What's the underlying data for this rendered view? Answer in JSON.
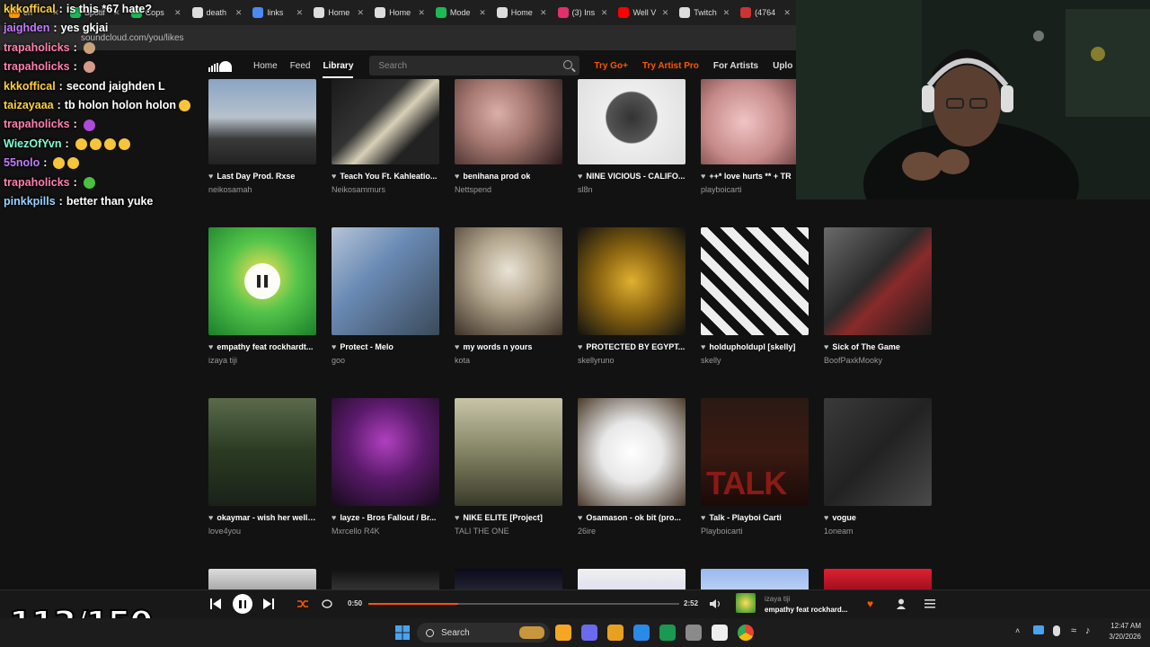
{
  "browser": {
    "tabs": [
      {
        "label": "en",
        "color": "#f90"
      },
      {
        "label": "Spotif",
        "color": "#1db954"
      },
      {
        "label": "Cops",
        "color": "#1db954"
      },
      {
        "label": "death",
        "color": "#ddd"
      },
      {
        "label": "links",
        "color": "#4a8af4"
      },
      {
        "label": "Home",
        "color": "#ddd"
      },
      {
        "label": "Home",
        "color": "#ddd"
      },
      {
        "label": "Mode",
        "color": "#1db954"
      },
      {
        "label": "Home",
        "color": "#ddd"
      },
      {
        "label": "(3) Ins",
        "color": "#e1306c"
      },
      {
        "label": "Well V",
        "color": "#f00"
      },
      {
        "label": "Twitch",
        "color": "#ddd"
      },
      {
        "label": "(4764",
        "color": "#c33"
      }
    ],
    "url": "soundcloud.com/you/likes"
  },
  "header": {
    "nav": [
      "Home",
      "Feed",
      "Library"
    ],
    "active": "Library",
    "search_placeholder": "Search",
    "try_go": "Try Go+",
    "try_artist": "Try Artist Pro",
    "for_artists": "For Artists",
    "upload": "Uplo"
  },
  "rows": [
    [
      {
        "title": "Last Day Prod. Rxse",
        "artist": "neikosamah",
        "bg": "linear-gradient(180deg,#8aa4c4 0%,#b7c2cc 45%,#3a3a3a 70%,#222 100%)"
      },
      {
        "title": "Teach You Ft. Kahleatio...",
        "artist": "Neikosammurs",
        "bg": "linear-gradient(135deg,#1a1a1a 0%,#333 40%,#d8d0b8 55%,#222 75%)"
      },
      {
        "title": "benihana prod ok",
        "artist": "Nettspend",
        "bg": "radial-gradient(circle at 40% 40%,#d9b0a8 0%,#a57770 40%,#2a1a1a 100%)"
      },
      {
        "title": "NINE VICIOUS - CALIFO...",
        "artist": "sl8n",
        "bg": "radial-gradient(circle at 50% 45%,#333 0%,#555 35%,#eee 37%,#ddd 100%)"
      },
      {
        "title": "++* love hurts ** + TR",
        "artist": "playboicarti",
        "bg": "radial-gradient(circle at 40% 50%,#f1c4c4 0%,#c68a8a 50%,#5a3030 100%)"
      }
    ],
    [
      {
        "title": "empathy feat rockhardt...",
        "artist": "izaya tiji",
        "bg": "radial-gradient(circle at 50% 45%,#fbe15a 0%,#54c44a 45%,#1a7f2a 100%)",
        "playing": true
      },
      {
        "title": "Protect - Melo",
        "artist": "goo",
        "bg": "linear-gradient(135deg,#b5c4d8 0%,#6a8ab4 40%,#3a4a5a 100%)"
      },
      {
        "title": "my words n yours",
        "artist": "kota",
        "bg": "radial-gradient(circle at 50% 40%,#e9e3d6 0%,#b4a68e 40%,#3c3228 100%)"
      },
      {
        "title": "PROTECTED BY EGYPT...",
        "artist": "skellyruno",
        "bg": "radial-gradient(circle at 50% 50%,#e0b030 0%,#8a6410 45%,#111 100%)"
      },
      {
        "title": "holdupholdupl [skelly]",
        "artist": "skelly",
        "bg": "repeating-linear-gradient(45deg,#eee 0 10px,#111 10px 20px)"
      },
      {
        "title": "Sick of The Game",
        "artist": "BoofPaxkMooky",
        "bg": "linear-gradient(135deg,#6a6a6a 0%,#2a2a2a 45%,#8a2a2a 60%,#1a1a1a 100%)"
      }
    ],
    [
      {
        "title": "okaymar - wish her well ...",
        "artist": "love4you",
        "bg": "linear-gradient(180deg,#5a6a4a 0%,#2a3a22 50%,#1a2218 100%)"
      },
      {
        "title": "Iayze - Bros Fallout / Br...",
        "artist": "Mxrcello R4K",
        "bg": "radial-gradient(circle at 50% 40%,#b040c0 0%,#5a1a6a 45%,#160a1a 100%)"
      },
      {
        "title": "NIKE ELITE [Project]",
        "artist": "TALI THE ONE",
        "bg": "linear-gradient(180deg,#c8c4a8 0%,#8a8a6a 45%,#3a3a2a 100%)"
      },
      {
        "title": "Osamason - ok bit (pro...",
        "artist": "26ire",
        "bg": "radial-gradient(circle at 50% 50%,#ffffff 0%,#e8e8e8 40%,#4a3a2a 100%)"
      },
      {
        "title": "Talk - Playboi Carti",
        "artist": "Playboicarti",
        "bg": "linear-gradient(180deg,#2a1a14 0%,#3a1a12 50%,#1a0a08 100%)",
        "text": "TALK"
      },
      {
        "title": "vogue",
        "artist": "1oneam",
        "bg": "linear-gradient(135deg,#3a3a3a 0%,#222 50%,#4a4a4a 100%)"
      }
    ],
    [
      {
        "bg": "linear-gradient(180deg,#ddd 0%,#aaa 100%)"
      },
      {
        "bg": "linear-gradient(180deg,#111 0%,#333 100%)"
      },
      {
        "bg": "linear-gradient(180deg,#0a0a1a 0%,#223 100%)"
      },
      {
        "bg": "linear-gradient(180deg,#f0f0f0 0%,#e0e0f0 100%)"
      },
      {
        "bg": "linear-gradient(180deg,#9ab8f0 0%,#b8cff5 100%)"
      },
      {
        "bg": "linear-gradient(180deg,#e02030 0%,#a01020 100%)"
      }
    ]
  ],
  "chat": [
    {
      "user": "kkkoffical",
      "color": "#ffd23f",
      "text": "is this *67 hate?"
    },
    {
      "user": "jaighden",
      "color": "#c27cff",
      "text": "yes gkjai"
    },
    {
      "user": "trapaholicks",
      "color": "#ff7fae",
      "text": "",
      "emote": "#c9a27a"
    },
    {
      "user": "trapaholicks",
      "color": "#ff7fae",
      "text": "",
      "emote": "#d59a8a"
    },
    {
      "user": "kkkoffical",
      "color": "#ffd23f",
      "text": "second jaighden L"
    },
    {
      "user": "taizayaaa",
      "color": "#ffd23f",
      "text": "tb holon holon holon",
      "emote": "#f7c43a"
    },
    {
      "user": "trapaholicks",
      "color": "#ff7fae",
      "text": "",
      "emote": "#b04ad8"
    },
    {
      "user": "WiezOfYvn",
      "color": "#7fffd4",
      "text": "",
      "emotes": 4
    },
    {
      "user": "55nolo",
      "color": "#c27cff",
      "text": "",
      "emotes": 2
    },
    {
      "user": "trapaholicks",
      "color": "#ff7fae",
      "text": "",
      "emote": "#4ac040"
    },
    {
      "user": "pinkkpills",
      "color": "#9ad1ff",
      "text": "better than yuke"
    }
  ],
  "player": {
    "elapsed": "0:50",
    "duration": "2:52",
    "progress": 0.29,
    "artist": "izaya tiji",
    "title": "empathy feat rockhard...",
    "counter": "113/150"
  },
  "taskbar": {
    "search": "Search",
    "time": "12:47 AM",
    "date": "3/20/2026"
  }
}
